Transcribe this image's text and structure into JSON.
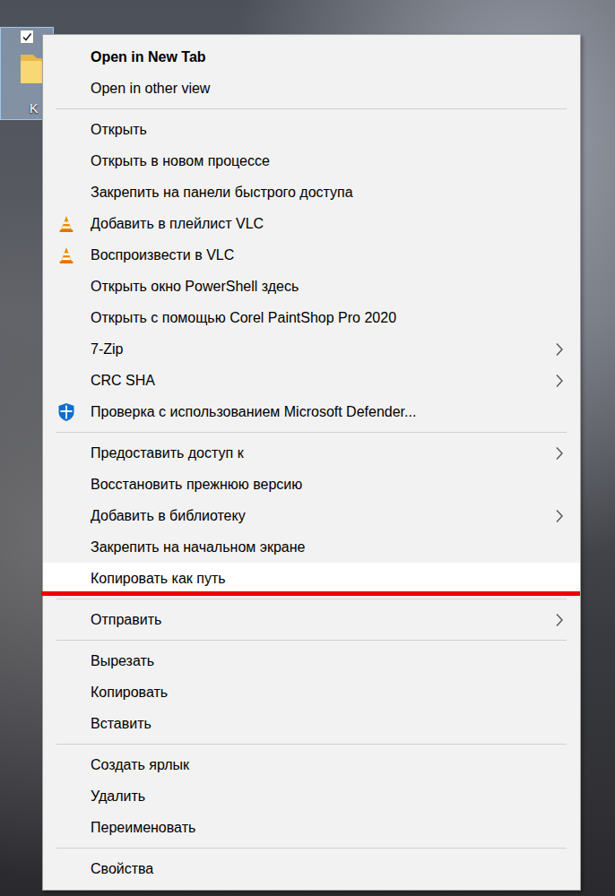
{
  "desktop": {
    "icon": {
      "label": "K",
      "selected": true,
      "checked": true
    }
  },
  "context_menu": {
    "groups": [
      {
        "items": [
          {
            "label": "Open in New Tab",
            "kind": "text",
            "bold": true,
            "submenu": false,
            "selected": false,
            "underlined": false
          },
          {
            "label": "Open in other view",
            "kind": "text",
            "bold": false,
            "submenu": false,
            "selected": false,
            "underlined": false
          }
        ]
      },
      {
        "items": [
          {
            "label": "Открыть",
            "kind": "text",
            "bold": false,
            "submenu": false,
            "selected": false,
            "underlined": false
          },
          {
            "label": "Открыть в новом процессе",
            "kind": "text",
            "bold": false,
            "submenu": false,
            "selected": false,
            "underlined": false
          },
          {
            "label": "Закрепить на панели быстрого доступа",
            "kind": "text",
            "bold": false,
            "submenu": false,
            "selected": false,
            "underlined": false
          },
          {
            "label": "Добавить в плейлист VLC",
            "kind": "vlc",
            "bold": false,
            "submenu": false,
            "selected": false,
            "underlined": false
          },
          {
            "label": "Воспроизвести в VLC",
            "kind": "vlc",
            "bold": false,
            "submenu": false,
            "selected": false,
            "underlined": false
          },
          {
            "label": "Открыть окно PowerShell здесь",
            "kind": "text",
            "bold": false,
            "submenu": false,
            "selected": false,
            "underlined": false
          },
          {
            "label": "Открыть с помощью Corel PaintShop Pro 2020",
            "kind": "text",
            "bold": false,
            "submenu": false,
            "selected": false,
            "underlined": false
          },
          {
            "label": "7-Zip",
            "kind": "text",
            "bold": false,
            "submenu": true,
            "selected": false,
            "underlined": false
          },
          {
            "label": "CRC SHA",
            "kind": "text",
            "bold": false,
            "submenu": true,
            "selected": false,
            "underlined": false
          },
          {
            "label": "Проверка с использованием Microsoft Defender...",
            "kind": "defender",
            "bold": false,
            "submenu": false,
            "selected": false,
            "underlined": false
          }
        ]
      },
      {
        "items": [
          {
            "label": "Предоставить доступ к",
            "kind": "text",
            "bold": false,
            "submenu": true,
            "selected": false,
            "underlined": false
          },
          {
            "label": "Восстановить прежнюю версию",
            "kind": "text",
            "bold": false,
            "submenu": false,
            "selected": false,
            "underlined": false
          },
          {
            "label": "Добавить в библиотеку",
            "kind": "text",
            "bold": false,
            "submenu": true,
            "selected": false,
            "underlined": false
          },
          {
            "label": "Закрепить на начальном экране",
            "kind": "text",
            "bold": false,
            "submenu": false,
            "selected": false,
            "underlined": false
          },
          {
            "label": "Копировать как путь",
            "kind": "text",
            "bold": false,
            "submenu": false,
            "selected": true,
            "underlined": true
          }
        ]
      },
      {
        "items": [
          {
            "label": "Отправить",
            "kind": "text",
            "bold": false,
            "submenu": true,
            "selected": false,
            "underlined": false
          }
        ]
      },
      {
        "items": [
          {
            "label": "Вырезать",
            "kind": "text",
            "bold": false,
            "submenu": false,
            "selected": false,
            "underlined": false
          },
          {
            "label": "Копировать",
            "kind": "text",
            "bold": false,
            "submenu": false,
            "selected": false,
            "underlined": false
          },
          {
            "label": "Вставить",
            "kind": "text",
            "bold": false,
            "submenu": false,
            "selected": false,
            "underlined": false
          }
        ]
      },
      {
        "items": [
          {
            "label": "Создать ярлык",
            "kind": "text",
            "bold": false,
            "submenu": false,
            "selected": false,
            "underlined": false
          },
          {
            "label": "Удалить",
            "kind": "text",
            "bold": false,
            "submenu": false,
            "selected": false,
            "underlined": false
          },
          {
            "label": "Переименовать",
            "kind": "text",
            "bold": false,
            "submenu": false,
            "selected": false,
            "underlined": false
          }
        ]
      },
      {
        "items": [
          {
            "label": "Свойства",
            "kind": "text",
            "bold": false,
            "submenu": false,
            "selected": false,
            "underlined": false
          }
        ]
      }
    ]
  }
}
